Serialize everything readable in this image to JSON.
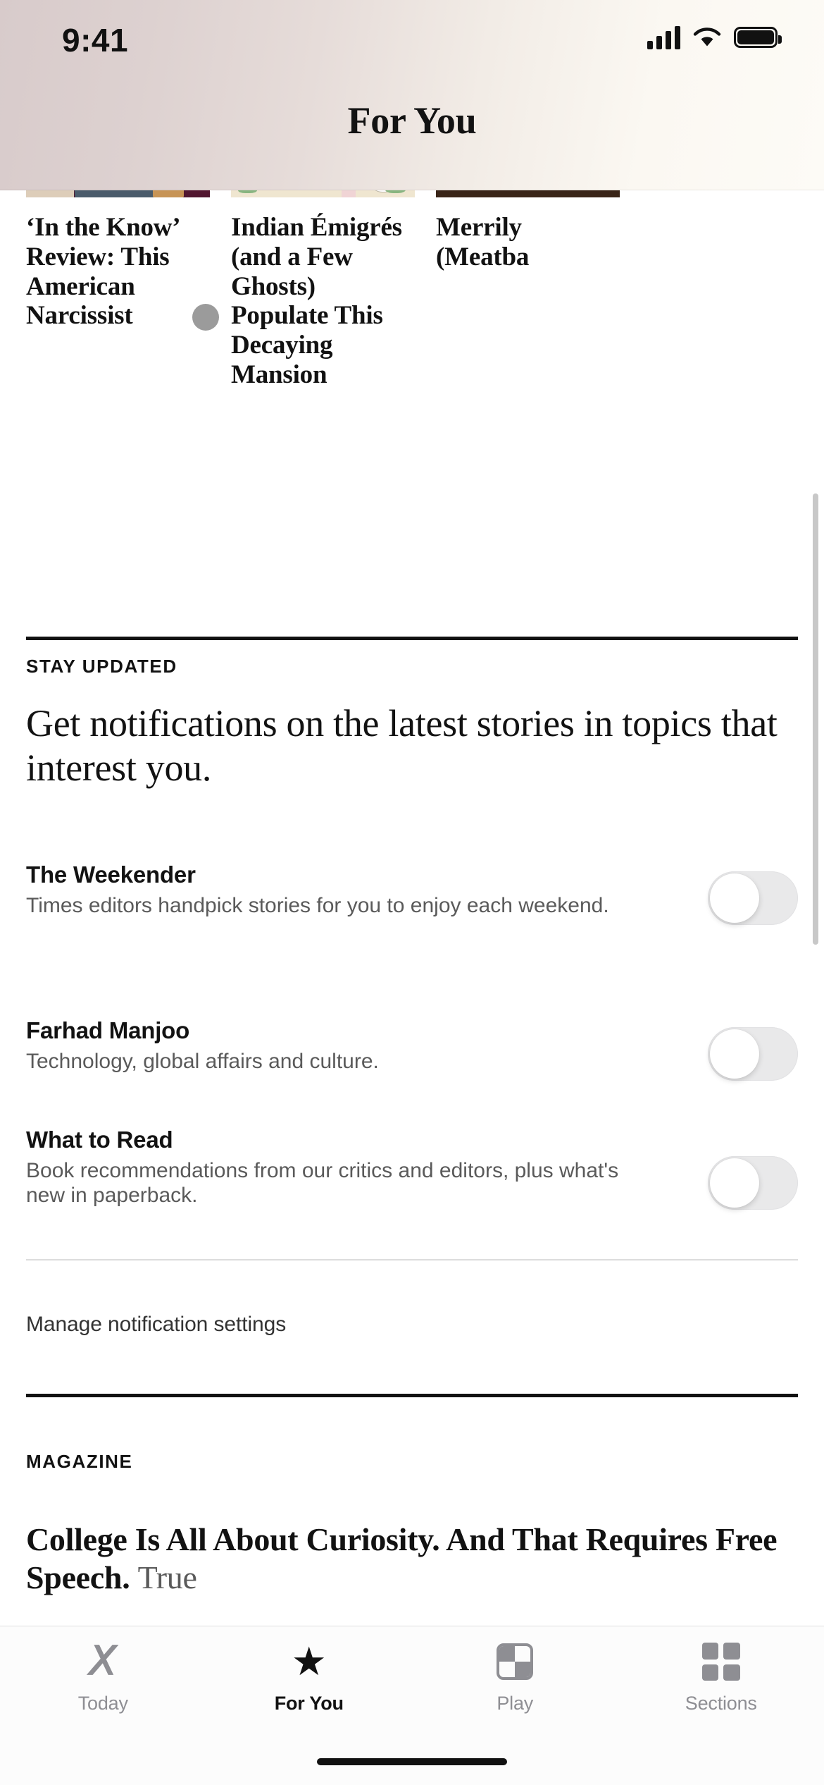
{
  "status_bar": {
    "time": "9:41",
    "cellular_icon": "signal-bars-icon",
    "wifi_icon": "wifi-icon",
    "battery_icon": "battery-icon"
  },
  "header": {
    "title": "For You"
  },
  "carousel": {
    "name": "recommended-stories-carousel",
    "cards": [
      {
        "title": "‘In the Know’ Review: This American Narcissist",
        "image_alt": "film-still-person-in-apron"
      },
      {
        "title": "Indian Émigrés (and a Few Ghosts) Populate This Decaying Mansion",
        "image_alt": "illustration-woman-in-black-dress"
      },
      {
        "title": "Merrily (Meatba",
        "image_alt": "food-photo-meatballs-with-herbs"
      }
    ]
  },
  "stay_updated": {
    "kicker": "STAY UPDATED",
    "headline": "Get notifications on the latest stories in topics that interest you.",
    "newsletters": [
      {
        "name": "The Weekender",
        "description": "Times editors handpick stories for you to enjoy each weekend.",
        "toggle_state": "off"
      },
      {
        "name": "Farhad Manjoo",
        "description": "Technology, global affairs and culture.",
        "toggle_state": "off"
      },
      {
        "name": "What to Read",
        "description": "Book recommendations from our critics and editors, plus what's new in paperback.",
        "toggle_state": "off"
      }
    ],
    "manage_link": "Manage notification settings"
  },
  "magazine": {
    "kicker": "MAGAZINE",
    "headline": "College Is All About Curiosity. And That Requires Free Speech.",
    "headline_trailing": "True"
  },
  "tab_bar": {
    "tabs": [
      {
        "label": "Today",
        "icon": "nyt-t-logo-icon",
        "active": false
      },
      {
        "label": "For You",
        "icon": "star-icon",
        "active": true
      },
      {
        "label": "Play",
        "icon": "play-games-icon",
        "active": false
      },
      {
        "label": "Sections",
        "icon": "grid-squares-icon",
        "active": false
      }
    ]
  },
  "colors": {
    "text_primary": "#121212",
    "text_secondary": "#5a5a5a",
    "tab_inactive": "#8e8e93",
    "toggle_off_track": "#e9e9ea",
    "rule_heavy": "#121212"
  }
}
